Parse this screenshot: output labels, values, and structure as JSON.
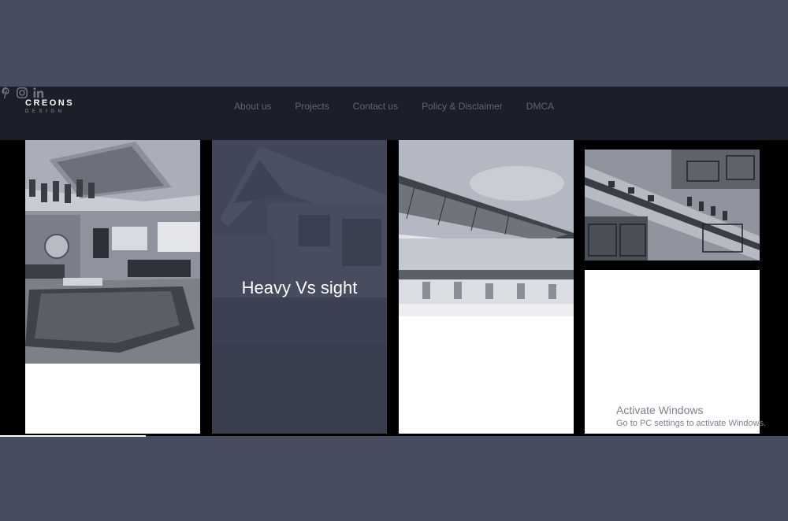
{
  "logo": {
    "main": "CREONS",
    "sub": "DESIGN"
  },
  "nav": {
    "items": [
      {
        "label": "About us"
      },
      {
        "label": "Projects"
      },
      {
        "label": "Contact us"
      },
      {
        "label": "Policy & Disclaimer"
      },
      {
        "label": "DMCA"
      }
    ]
  },
  "social": [
    {
      "icon": "pinterest-icon"
    },
    {
      "icon": "instagram-icon"
    },
    {
      "icon": "linkedin-icon"
    }
  ],
  "gallery": {
    "featured_title": "Heavy Vs sight"
  },
  "watermark": {
    "title": "Activate Windows",
    "subtitle": "Go to PC settings to activate Windows."
  },
  "colors": {
    "page_band": "#474c5e",
    "navbar": "#1b1f29",
    "nav_link": "#5e6577",
    "stage": "#000000",
    "overlay": "#3a4051"
  }
}
